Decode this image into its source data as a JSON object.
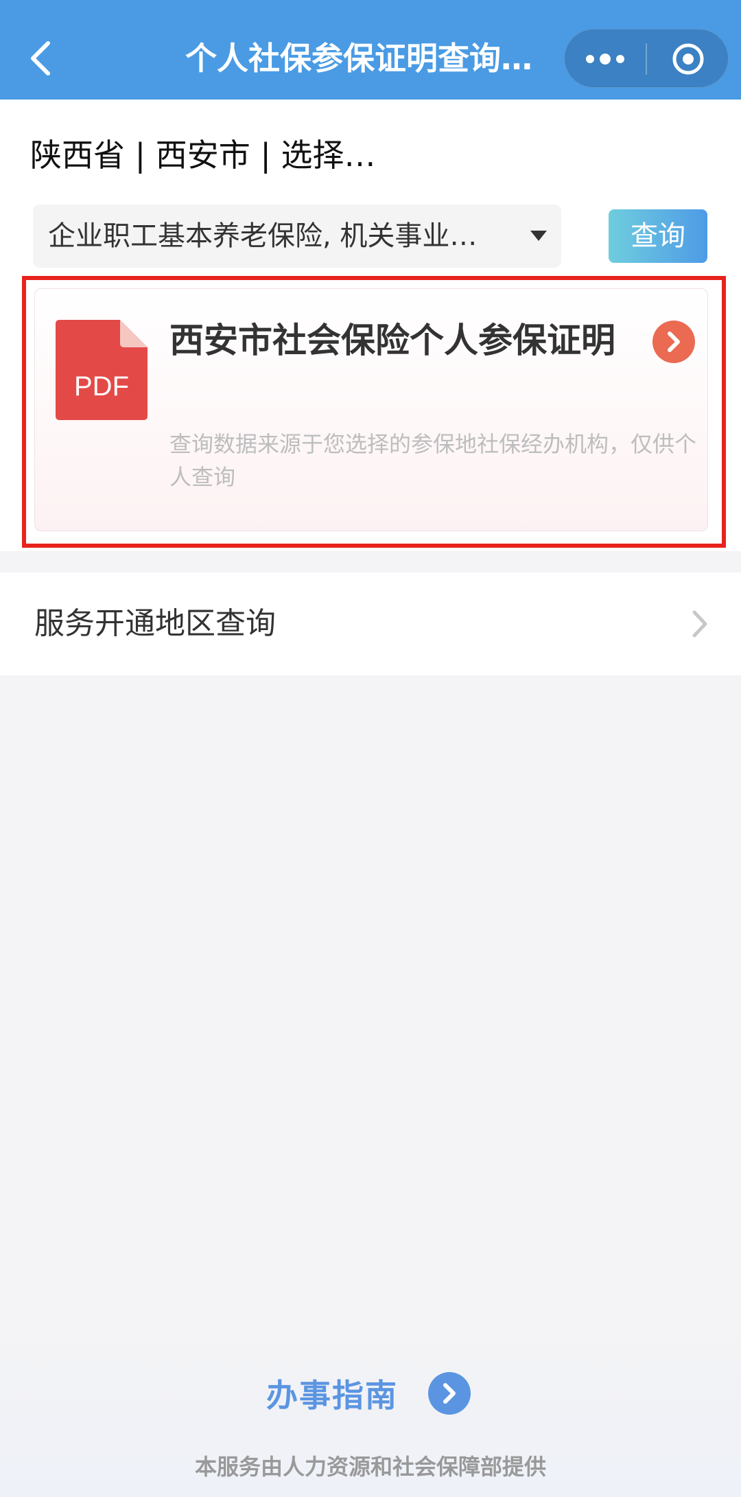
{
  "header": {
    "title": "个人社保参保证明查询…",
    "back_icon": "chevron-left-icon",
    "more_icon": "more-dots-icon",
    "close_icon": "target-circle-icon",
    "background": "#4a9be4"
  },
  "location": {
    "text": "陕西省 | 西安市 | 选择…"
  },
  "insurance_select": {
    "value": "企业职工基本养老保险, 机关事业…",
    "caret_icon": "caret-down-icon"
  },
  "query_button": {
    "label": "查询"
  },
  "certificate_card": {
    "icon": "pdf-file-icon",
    "icon_text": "PDF",
    "title": "西安市社会保险个人参保证明",
    "description": "查询数据来源于您选择的参保地社保经办机构，仅供个人查询",
    "arrow_icon": "chevron-right-circle-icon",
    "highlight_color": "#e8231d"
  },
  "service_area": {
    "label": "服务开通地区查询",
    "chevron_icon": "chevron-right-icon"
  },
  "footer": {
    "guide_label": "办事指南",
    "guide_icon": "chevron-right-circle-icon",
    "provider_text": "本服务由人力资源和社会保障部提供"
  }
}
